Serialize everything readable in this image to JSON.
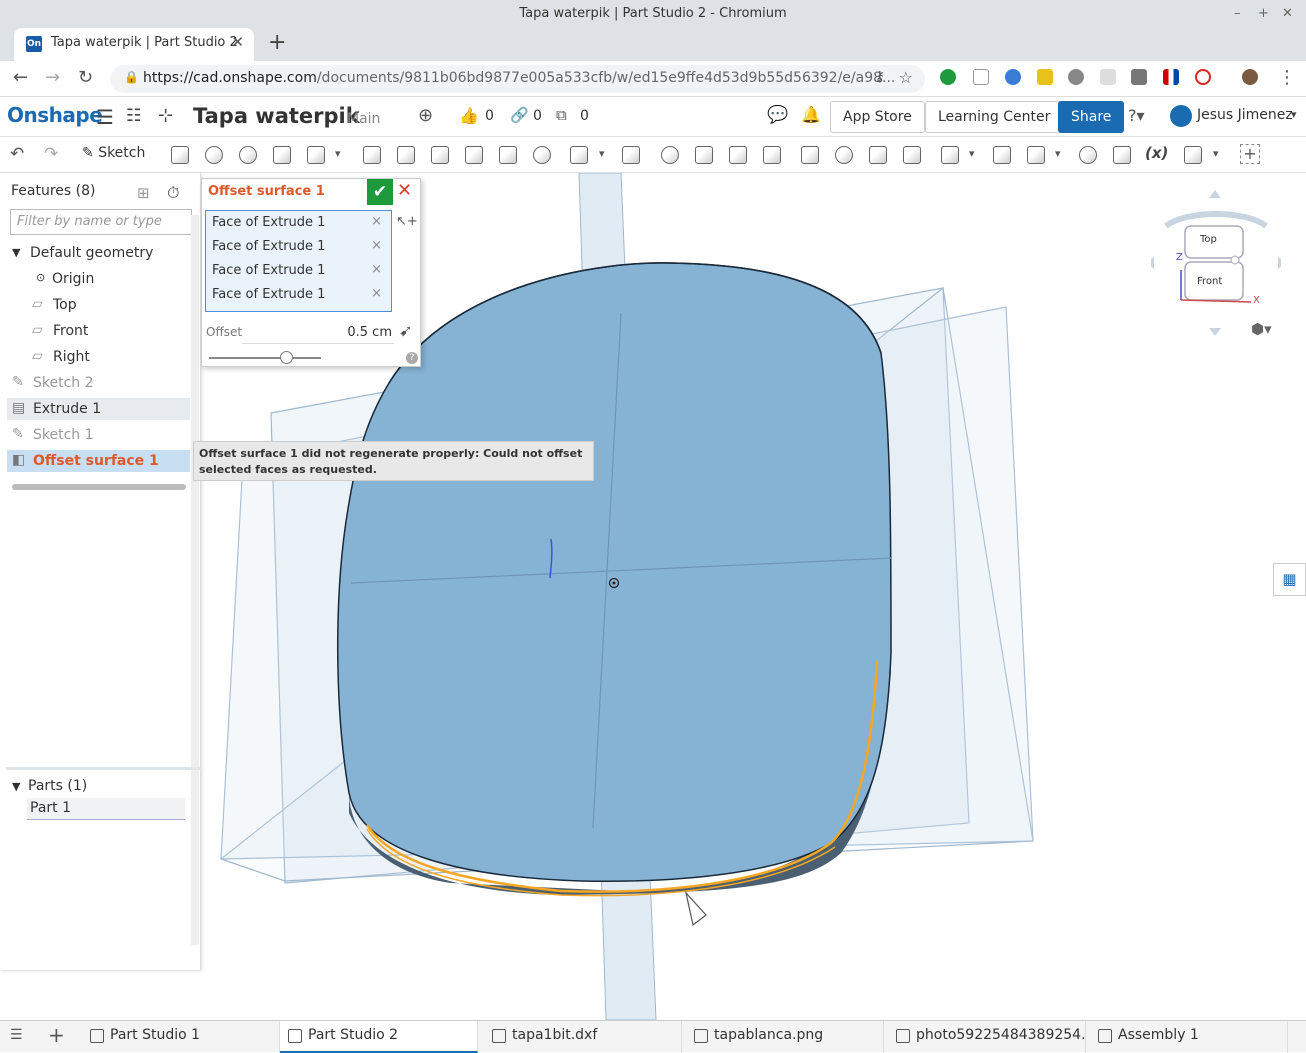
{
  "browser": {
    "window_title": "Tapa waterpik | Part Studio 2 - Chromium",
    "tab_title": "Tapa waterpik | Part Studio 2",
    "tab_favicon_text": "On",
    "url_host": "https://cad.onshape.com",
    "url_path": "/documents/9811b06bd9877e005a533cfb/w/ed15e9ffe4d53d9b55d56392/e/a98..."
  },
  "app": {
    "logo": "Onshape",
    "document_name": "Tapa waterpik",
    "branch": "Main",
    "likes": "0",
    "links": "0",
    "copies": "0",
    "app_store": "App Store",
    "learning_center": "Learning Center",
    "share": "Share",
    "user": "Jesus Jimenez"
  },
  "toolbar": {
    "sketch": "Sketch",
    "variable": "(x)"
  },
  "features": {
    "header": "Features (8)",
    "filter_placeholder": "Filter by name or type",
    "default_geometry": "Default geometry",
    "items": [
      {
        "label": "Origin"
      },
      {
        "label": "Top"
      },
      {
        "label": "Front"
      },
      {
        "label": "Right"
      },
      {
        "label": "Sketch 2"
      },
      {
        "label": "Extrude 1"
      },
      {
        "label": "Sketch 1"
      },
      {
        "label": "Offset surface 1"
      }
    ],
    "parts_header": "Parts (1)",
    "part": "Part 1"
  },
  "dialog": {
    "title": "Offset surface 1",
    "faces": [
      "Face of Extrude 1",
      "Face of Extrude 1",
      "Face of Extrude 1",
      "Face of Extrude 1"
    ],
    "offset_label": "Offset",
    "offset_value": "0.5 cm",
    "slider_level": 0.7
  },
  "tooltip": "Offset surface 1 did not regenerate properly: Could not offset selected faces as requested.",
  "viewcube": {
    "top": "Top",
    "front": "Front",
    "axis_z": "Z",
    "axis_x": "X"
  },
  "bottom_tabs": [
    {
      "label": "Part Studio 1"
    },
    {
      "label": "Part Studio 2"
    },
    {
      "label": "tapa1bit.dxf"
    },
    {
      "label": "tapablanca.png"
    },
    {
      "label": "photo59225484389254..."
    },
    {
      "label": "Assembly 1"
    }
  ],
  "colors": {
    "brand": "#1b6bb3",
    "error": "#e0582a",
    "ok": "#1e9a3d",
    "part_fill": "#7fadd0",
    "selected_edge": "#f5a623"
  }
}
